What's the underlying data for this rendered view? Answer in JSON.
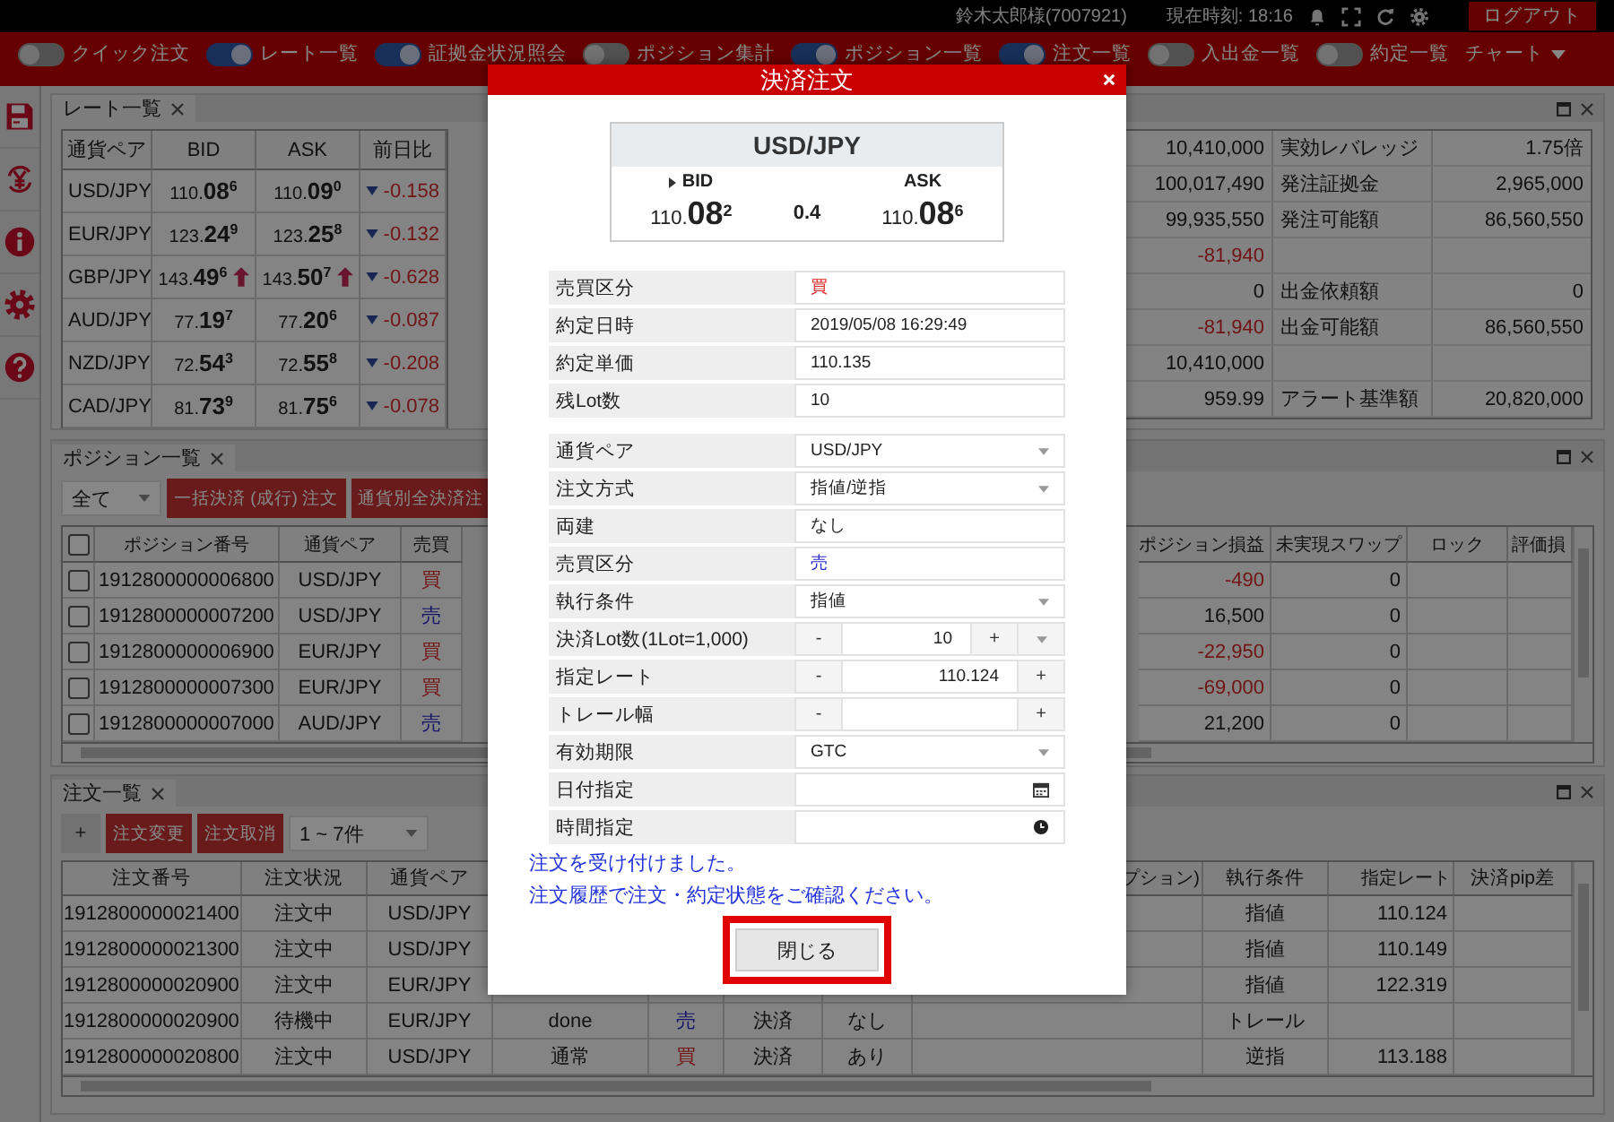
{
  "header": {
    "user": "鈴木太郎様(7007921)",
    "clock": "現在時刻: 18:16",
    "logout": "ログアウト"
  },
  "toolbar": {
    "toggles": [
      {
        "label": "クイック注文",
        "on": false
      },
      {
        "label": "レート一覧",
        "on": true
      },
      {
        "label": "証拠金状況照会",
        "on": true
      },
      {
        "label": "ポジション集計",
        "on": false
      },
      {
        "label": "ポジション一覧",
        "on": true
      },
      {
        "label": "注文一覧",
        "on": true
      },
      {
        "label": "入出金一覧",
        "on": false
      },
      {
        "label": "約定一覧",
        "on": false
      }
    ],
    "chart_menu": "チャート"
  },
  "rate_panel": {
    "tab": "レート一覧",
    "columns": [
      "通貨ペア",
      "BID",
      "ASK",
      "前日比"
    ],
    "rows": [
      {
        "pair": "USD/JPY",
        "bid": "110.**08**$^{6}$",
        "ask": "110.**09**$^{0}$",
        "bid_up": false,
        "ask_up": false,
        "change": "-0.158"
      },
      {
        "pair": "EUR/JPY",
        "bid": "123.**24**$^{9}$",
        "ask": "123.**25**$^{8}$",
        "bid_up": false,
        "ask_up": false,
        "change": "-0.132"
      },
      {
        "pair": "GBP/JPY",
        "bid": "143.**49**$^{6}$",
        "ask": "143.**50**$^{7}$",
        "bid_up": true,
        "ask_up": true,
        "change": "-0.628"
      },
      {
        "pair": "AUD/JPY",
        "bid": "77.**19**$^{7}$",
        "ask": "77.**20**$^{6}$",
        "bid_up": false,
        "ask_up": false,
        "change": "-0.087"
      },
      {
        "pair": "NZD/JPY",
        "bid": "72.**54**$^{3}$",
        "ask": "72.**55**$^{8}$",
        "bid_up": false,
        "ask_up": false,
        "change": "-0.208"
      },
      {
        "pair": "CAD/JPY",
        "bid": "81.**73**$^{9}$",
        "ask": "81.**75**$^{6}$",
        "bid_up": false,
        "ask_up": false,
        "change": "-0.078"
      }
    ]
  },
  "account_panel": {
    "rows": [
      {
        "value_1": "10,410,000",
        "negative": false,
        "label": "実効レバレッジ",
        "value_2": "1.75倍"
      },
      {
        "value_1": "100,017,490",
        "negative": false,
        "label": "発注証拠金",
        "value_2": "2,965,000"
      },
      {
        "value_1": "99,935,550",
        "negative": false,
        "label": "発注可能額",
        "value_2": "86,560,550"
      },
      {
        "value_1": "-81,940",
        "negative": true
      },
      {
        "value_1": "0",
        "negative": false,
        "label": "出金依頼額",
        "value_2": "0"
      },
      {
        "value_1": "-81,940",
        "negative": true,
        "label": "出金可能額",
        "value_2": "86,560,550"
      },
      {
        "value_1": "10,410,000",
        "negative": false
      },
      {
        "value_1": "959.99",
        "negative": false,
        "label": "アラート基準額",
        "value_2": "20,820,000"
      }
    ]
  },
  "position_panel": {
    "tab": "ポジション一覧",
    "filter": "全て",
    "buttons": [
      "一括決済 (成行) 注文",
      "通貨別全決済注"
    ],
    "header_checked": false,
    "columns_left": [
      "ポジション番号",
      "通貨ペア",
      "売買"
    ],
    "columns_right": [
      "ポジション損益",
      "未実現スワップ",
      "ロック",
      "評価損"
    ],
    "rows": [
      {
        "checked": false,
        "id": "1912800000006800",
        "pair": "USD/JPY",
        "side": "買",
        "kind": "buy",
        "pl": "-490",
        "negative": true,
        "swap": "0"
      },
      {
        "checked": false,
        "id": "1912800000007200",
        "pair": "USD/JPY",
        "side": "売",
        "kind": "sell",
        "pl": "16,500",
        "negative": false,
        "swap": "0"
      },
      {
        "checked": false,
        "id": "1912800000006900",
        "pair": "EUR/JPY",
        "side": "買",
        "kind": "buy",
        "pl": "-22,950",
        "negative": true,
        "swap": "0"
      },
      {
        "checked": false,
        "id": "1912800000007300",
        "pair": "EUR/JPY",
        "side": "買",
        "kind": "buy",
        "pl": "-69,000",
        "negative": true,
        "swap": "0"
      },
      {
        "checked": false,
        "id": "1912800000007000",
        "pair": "AUD/JPY",
        "side": "売",
        "kind": "sell",
        "pl": "21,200",
        "negative": false,
        "swap": "0"
      }
    ]
  },
  "order_panel": {
    "tab": "注文一覧",
    "add": "+",
    "buttons": [
      "注文変更",
      "注文取消"
    ],
    "range": "1 ~ 7件",
    "header": {
      "order_no": "注文番号",
      "status": "注文状況",
      "pair": "通貨ペア",
      "column_8": "プション)",
      "exec": "執行条件",
      "rate": "指定レート",
      "pip": "決済pip差"
    },
    "rows": [
      {
        "order_no": "1912800000021400",
        "status": "注文中",
        "pair": "USD/JPY",
        "exec": "指値",
        "rate": "110.124"
      },
      {
        "order_no": "1912800000021300",
        "status": "注文中",
        "pair": "USD/JPY",
        "exec": "指値",
        "rate": "110.149"
      },
      {
        "order_no": "1912800000020900",
        "status": "注文中",
        "pair": "EUR/JPY",
        "exec": "指値",
        "rate": "122.319"
      },
      {
        "order_no": "1912800000020900",
        "status": "待機中",
        "pair": "EUR/JPY",
        "column_4": "done",
        "side": "売",
        "kind": "sell",
        "column_6": "決済",
        "column_7": "なし",
        "exec": "トレール"
      },
      {
        "order_no": "1912800000020800",
        "status": "注文中",
        "pair": "USD/JPY",
        "column_4": "通常",
        "side": "買",
        "kind": "buy",
        "column_6": "決済",
        "column_7": "あり",
        "exec": "逆指",
        "rate": "113.188"
      }
    ]
  },
  "dialog": {
    "title": "決済注文",
    "pair": "USD/JPY",
    "bid_label": "BID",
    "ask_label": "ASK",
    "bid": "110.**08**$^{2}$",
    "spread": "0.4",
    "ask": "110.**08**$^{6}$",
    "summary": [
      {
        "label": "売買区分",
        "value": "買",
        "color": "#e02828"
      },
      {
        "label": "約定日時",
        "value": "2019/05/08 16:29:49"
      },
      {
        "label": "約定単価",
        "value": "110.135"
      },
      {
        "label": "残Lot数",
        "value": "10"
      }
    ],
    "fields": [
      {
        "kind": "select",
        "label": "通貨ペア",
        "value": "USD/JPY"
      },
      {
        "kind": "select",
        "label": "注文方式",
        "value": "指値/逆指"
      },
      {
        "kind": "text",
        "label": "両建",
        "value": "なし"
      },
      {
        "kind": "text",
        "label": "売買区分",
        "value": "売",
        "color": "#2828c8"
      },
      {
        "kind": "select",
        "label": "執行条件",
        "value": "指値"
      },
      {
        "kind": "stepper",
        "label": "決済Lot数(1Lot=1,000)",
        "value": "10",
        "minus": "-",
        "plus": "+",
        "dropdown": true
      },
      {
        "kind": "stepper",
        "label": "指定レート",
        "value": "110.124",
        "minus": "-",
        "plus": "+",
        "dropdown": false
      },
      {
        "kind": "stepper",
        "label": "トレール幅",
        "minus": "-",
        "plus": "+",
        "dropdown": false
      },
      {
        "kind": "select",
        "label": "有効期限",
        "value": "GTC"
      },
      {
        "kind": "date",
        "label": "日付指定"
      },
      {
        "kind": "time",
        "label": "時間指定"
      }
    ],
    "messages": [
      "注文を受け付けました。",
      "注文履歴で注文・約定状態をご確認ください。"
    ],
    "close": "閉じる",
    "close_highlighted": true
  }
}
